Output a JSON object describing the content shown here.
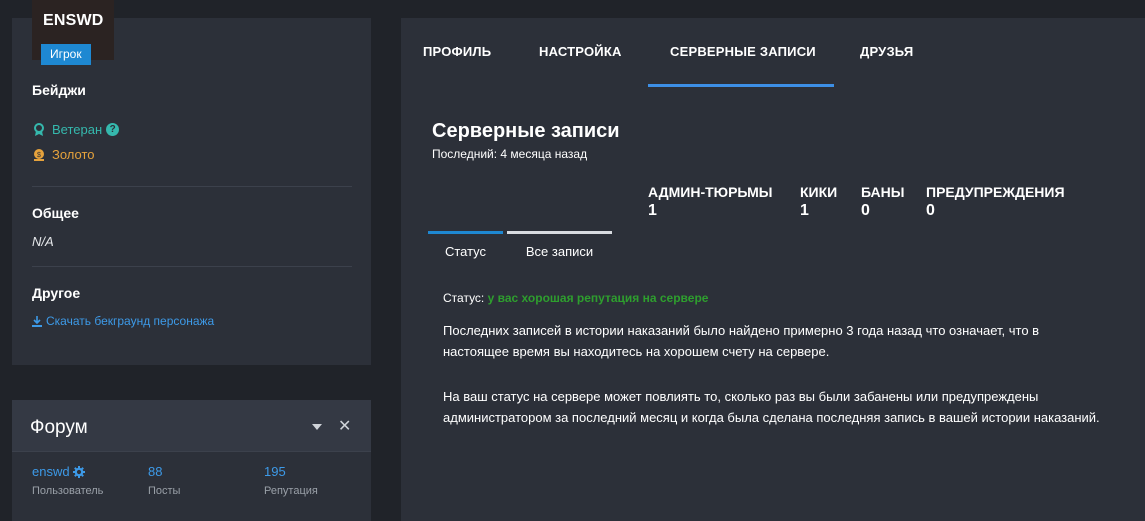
{
  "profile": {
    "username": "ENSWD",
    "role": "Игрок"
  },
  "badges": {
    "title": "Бейджи",
    "items": [
      {
        "label": "Ветеран",
        "icon": "award-icon",
        "color": "#35b8ad"
      },
      {
        "label": "Золото",
        "icon": "coin-icon",
        "color": "#e6a23c"
      }
    ],
    "help_glyph": "?"
  },
  "general": {
    "title": "Общее",
    "value": "N/A"
  },
  "other": {
    "title": "Другое",
    "download_link": "Скачать бекграунд персонажа"
  },
  "forum": {
    "title": "Форум",
    "close_glyph": "✕",
    "stats": [
      {
        "value": "enswd",
        "label": "Пользователь"
      },
      {
        "value": "88",
        "label": "Посты"
      },
      {
        "value": "195",
        "label": "Репутация"
      }
    ]
  },
  "tabs": [
    {
      "label": "ПРОФИЛЬ"
    },
    {
      "label": "НАСТРОЙКА"
    },
    {
      "label": "СЕРВЕРНЫЕ ЗАПИСИ"
    },
    {
      "label": "ДРУЗЬЯ"
    }
  ],
  "records": {
    "title": "Серверные записи",
    "last": "Последний: 4 месяца назад",
    "counters": [
      {
        "title": "АДМИН-ТЮРЬМЫ",
        "value": "1"
      },
      {
        "title": "КИКИ",
        "value": "1"
      },
      {
        "title": "БАНЫ",
        "value": "0"
      },
      {
        "title": "ПРЕДУПРЕЖДЕНИЯ",
        "value": "0"
      }
    ],
    "subtabs": [
      {
        "label": "Статус"
      },
      {
        "label": "Все записи"
      }
    ],
    "status_label": "Статус:",
    "status_value": "у вас хорошая репутация на сервере",
    "paragraph1": "Последних записей в истории наказаний было найдено примерно 3 года назад что означает, что в настоящее время вы находитесь на хорошем счету на сервере.",
    "paragraph2": "На ваш статус на сервере может повлиять то, сколько раз вы были забанены или предупреждены администратором за последний месяц и когда была сделана последняя запись в вашей истории наказаний."
  },
  "colors": {
    "accent": "#3d8fe6",
    "good": "#2e9e2e",
    "link": "#3d9ae8"
  }
}
